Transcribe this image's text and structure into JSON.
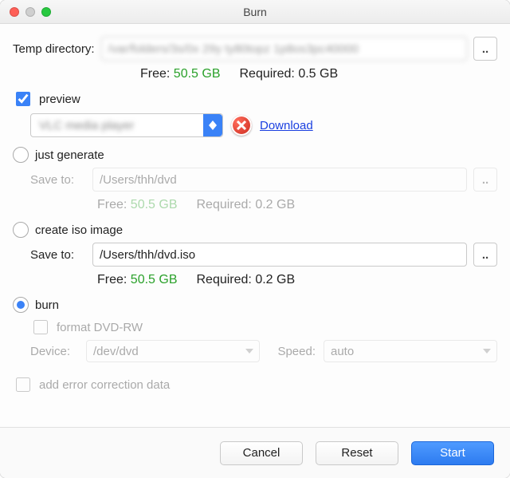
{
  "window": {
    "title": "Burn"
  },
  "tempdir": {
    "label": "Temp directory:",
    "value": "/var/folders/3s/0x 29y ty80topz 1p8os3pc40000",
    "browse": "..",
    "free_label": "Free:",
    "free_value": "50.5 GB",
    "required_label": "Required:",
    "required_value": "0.5 GB"
  },
  "preview": {
    "label": "preview",
    "checked": true,
    "player": "VLC media player",
    "download": "Download"
  },
  "just_generate": {
    "label": "just generate",
    "save_label": "Save to:",
    "save_value": "/Users/thh/dvd",
    "browse": "..",
    "free_label": "Free:",
    "free_value": "50.5 GB",
    "required_label": "Required:",
    "required_value": "0.2 GB"
  },
  "create_iso": {
    "label": "create iso image",
    "save_label": "Save to:",
    "save_value": "/Users/thh/dvd.iso",
    "browse": "..",
    "free_label": "Free:",
    "free_value": "50.5 GB",
    "required_label": "Required:",
    "required_value": "0.2 GB"
  },
  "burn": {
    "label": "burn",
    "selected": true,
    "format_label": "format DVD-RW",
    "device_label": "Device:",
    "device_value": "/dev/dvd",
    "speed_label": "Speed:",
    "speed_value": "auto"
  },
  "error_correction": {
    "label": "add error correction data"
  },
  "footer": {
    "cancel": "Cancel",
    "reset": "Reset",
    "start": "Start"
  }
}
